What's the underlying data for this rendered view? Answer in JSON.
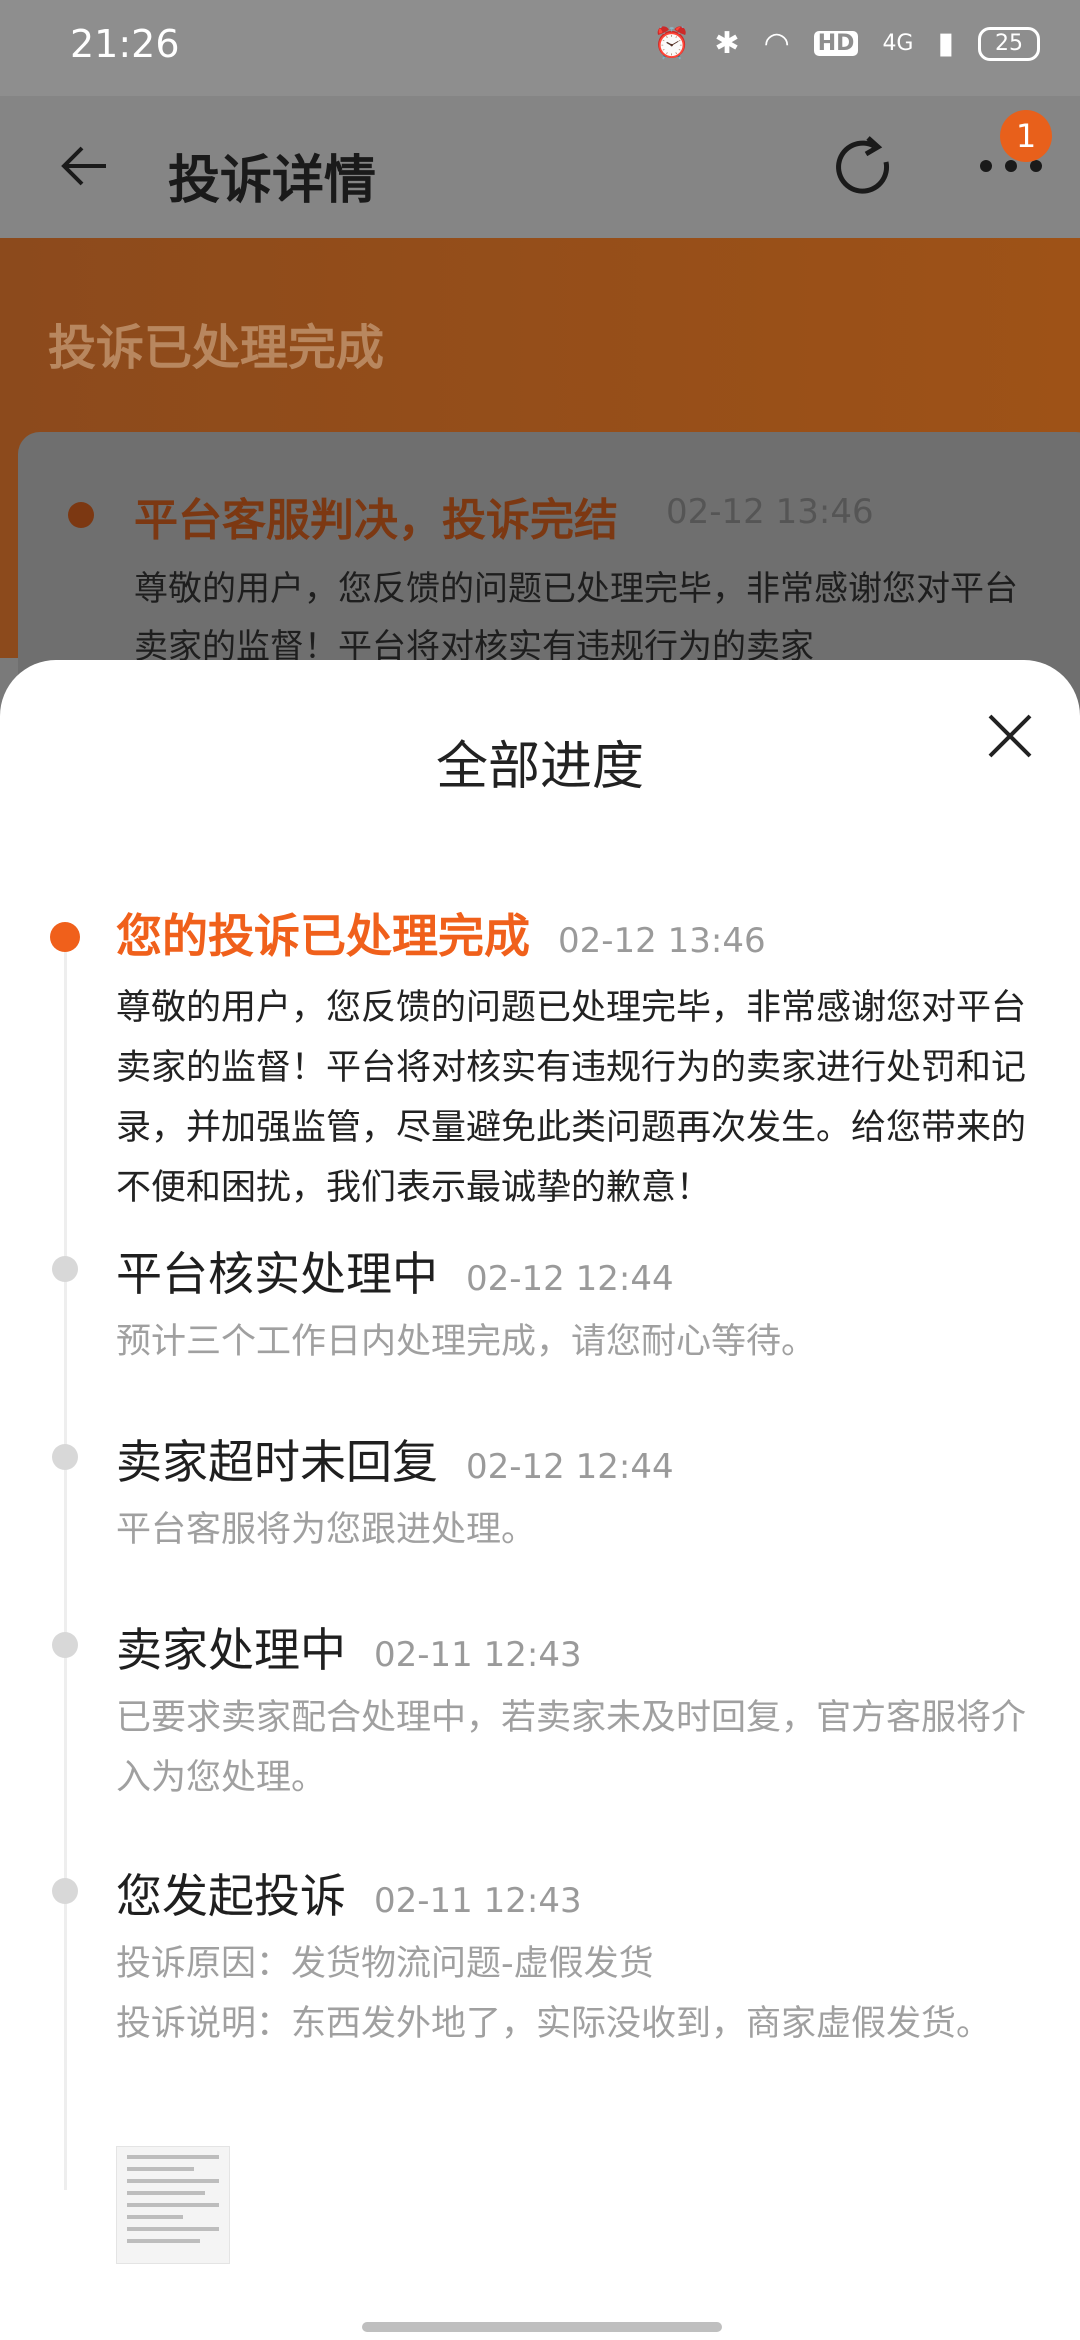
{
  "status_bar": {
    "time": "21:26",
    "network": "4G",
    "hd": "HD",
    "battery": "25"
  },
  "app_bar": {
    "title": "投诉详情",
    "badge": "1"
  },
  "banner": {
    "status": "投诉已处理完成",
    "card_title": "平台客服判决，投诉完结",
    "card_time": "02-12 13:46",
    "card_text": "尊敬的用户，您反馈的问题已处理完毕，非常感谢您对平台卖家的监督！平台将对核实有违规行为的卖家"
  },
  "sheet": {
    "title": "全部进度",
    "items": [
      {
        "title": "您的投诉已处理完成",
        "time": "02-12 13:46",
        "desc": "尊敬的用户，您反馈的问题已处理完毕，非常感谢您对平台卖家的监督！平台将对核实有违规行为的卖家进行处罚和记录，并加强监管，尽量避免此类问题再次发生。给您带来的不便和困扰，我们表示最诚挚的歉意！"
      },
      {
        "title": "平台核实处理中",
        "time": "02-12 12:44",
        "desc": "预计三个工作日内处理完成，请您耐心等待。"
      },
      {
        "title": "卖家超时未回复",
        "time": "02-12 12:44",
        "desc": "平台客服将为您跟进处理。"
      },
      {
        "title": "卖家处理中",
        "time": "02-11 12:43",
        "desc": "已要求卖家配合处理中，若卖家未及时回复，官方客服将介入为您处理。"
      },
      {
        "title": "您发起投诉",
        "time": "02-11 12:43",
        "reason": "投诉原因：发货物流问题-虚假发货",
        "desc": "投诉说明：东西发外地了，实际没收到，商家虚假发货。"
      }
    ]
  },
  "colors": {
    "accent": "#f0601b",
    "muted_text": "#a0a0a0"
  },
  "icons": {
    "back": "arrow-left-icon",
    "refresh": "refresh-icon",
    "more": "more-dots-icon",
    "close": "close-icon"
  }
}
